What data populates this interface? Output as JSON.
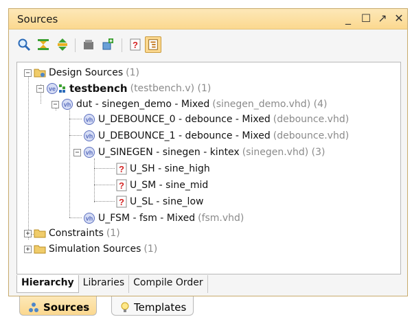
{
  "panel": {
    "title": "Sources",
    "controls": [
      "_",
      "☐",
      "↗",
      "✕"
    ]
  },
  "toolbar": {
    "buttons": [
      {
        "name": "search-icon"
      },
      {
        "name": "collapse-all-icon"
      },
      {
        "name": "expand-all-icon"
      },
      {
        "name": "add-sources-icon"
      },
      {
        "name": "hierarchy-update-icon"
      },
      {
        "name": "unknown-icon"
      },
      {
        "name": "show-hierarchy-icon",
        "active": true
      }
    ]
  },
  "tree": {
    "design_sources": {
      "label": "Design Sources",
      "count": "(1)"
    },
    "testbench": {
      "label": "testbench",
      "file": "(testbench.v) (1)"
    },
    "dut": {
      "label": "dut - sinegen_demo - Mixed",
      "file": "(sinegen_demo.vhd) (4)"
    },
    "debounce0": {
      "label": "U_DEBOUNCE_0 - debounce - Mixed",
      "file": "(debounce.vhd)"
    },
    "debounce1": {
      "label": "U_DEBOUNCE_1 - debounce - Mixed",
      "file": "(debounce.vhd)"
    },
    "sinegen": {
      "label": "U_SINEGEN - sinegen - kintex",
      "file": "(sinegen.vhd) (3)"
    },
    "ush": {
      "label": "U_SH - sine_high"
    },
    "usm": {
      "label": "U_SM - sine_mid"
    },
    "usl": {
      "label": "U_SL - sine_low"
    },
    "fsm": {
      "label": "U_FSM - fsm - Mixed",
      "file": "(fsm.vhd)"
    },
    "constraints": {
      "label": "Constraints",
      "count": "(1)"
    },
    "simulation": {
      "label": "Simulation Sources",
      "count": "(1)"
    }
  },
  "bottom_tabs": [
    "Hierarchy",
    "Libraries",
    "Compile Order"
  ],
  "outer_tabs": [
    "Sources",
    "Templates"
  ],
  "colors": {
    "title_bar": "#fbd88f",
    "secondary_text": "#8a8a8a",
    "vhdl_icon": "#5b6fbf",
    "unknown_icon": "#d42424"
  }
}
